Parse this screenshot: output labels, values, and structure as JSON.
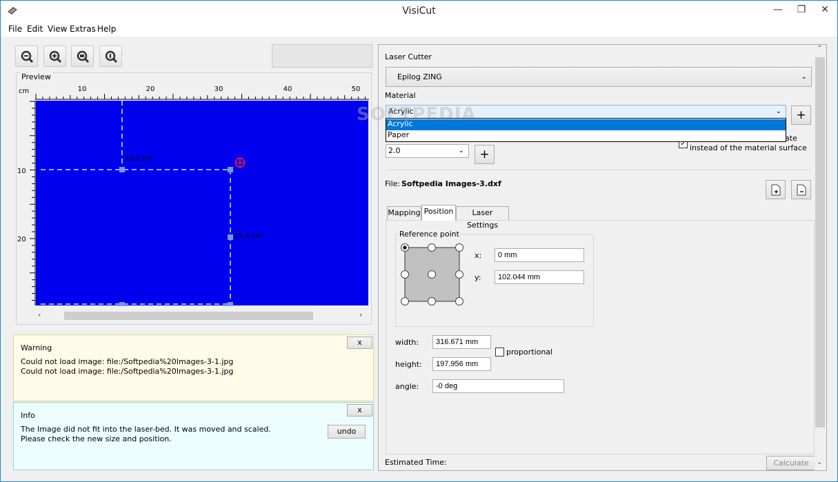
{
  "window": {
    "title": "VisiCut",
    "minimize": "—",
    "restore": "❐",
    "close": "✕"
  },
  "menu": [
    "File",
    "Edit",
    "View",
    "Extras",
    "Help"
  ],
  "toolbar": {
    "icons": [
      "zoom-out-icon",
      "zoom-in-icon",
      "zoom-fit-icon",
      "zoom-1to1-icon"
    ]
  },
  "preview": {
    "label": "Preview",
    "unit": "cm",
    "h_ticks": [
      "10",
      "20",
      "30",
      "40",
      "50"
    ],
    "v_ticks": [
      "10",
      "20"
    ],
    "width_label": "10,2 cm",
    "height_label": "19,8 cm",
    "canvas_color": "#0000ee"
  },
  "warning": {
    "title": "Warning",
    "close": "x",
    "lines": [
      "Could not load image: file:/Softpedia%20Images-3-1.jpg",
      "Could not load image: file:/Softpedia%20Images-3-1.jpg"
    ]
  },
  "info": {
    "title": "Info",
    "close": "x",
    "lines": [
      "The Image did not fit into the laser-bed. It was moved and scaled.",
      "Please check the new size and position."
    ],
    "undo": "undo"
  },
  "laser": {
    "label": "Laser Cutter",
    "value": "Epilog ZING"
  },
  "material": {
    "label": "Material",
    "value": "Acrylic",
    "options": [
      "Acrylic",
      "Paper"
    ],
    "add": "+",
    "thickness": "2.0",
    "add_thickness": "+",
    "focus_partial": "late",
    "focus_note": "instead of the material surface",
    "focus_checked": "✓"
  },
  "file": {
    "label": "File:",
    "name": "Softpedia Images-3.dxf"
  },
  "tabs": [
    "Mapping",
    "Position",
    "Laser Settings"
  ],
  "position": {
    "ref_label": "Reference point",
    "x_label": "x:",
    "x_value": "0 mm",
    "y_label": "y:",
    "y_value": "102.044 mm",
    "width_label": "width:",
    "width_value": "316.671 mm",
    "proportional": "proportional",
    "height_label": "height:",
    "height_value": "197.956 mm",
    "angle_label": "angle:",
    "angle_value": "-0 deg"
  },
  "estimate": {
    "label": "Estimated Time:",
    "button": "Calculate"
  },
  "watermark": "SOFTPEDIA"
}
